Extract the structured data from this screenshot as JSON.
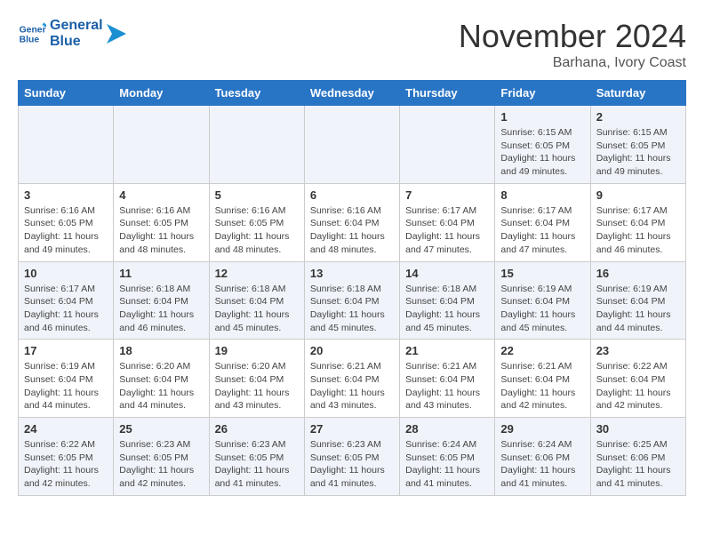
{
  "header": {
    "logo_line1": "General",
    "logo_line2": "Blue",
    "month": "November 2024",
    "location": "Barhana, Ivory Coast"
  },
  "weekdays": [
    "Sunday",
    "Monday",
    "Tuesday",
    "Wednesday",
    "Thursday",
    "Friday",
    "Saturday"
  ],
  "weeks": [
    [
      {
        "day": "",
        "info": ""
      },
      {
        "day": "",
        "info": ""
      },
      {
        "day": "",
        "info": ""
      },
      {
        "day": "",
        "info": ""
      },
      {
        "day": "",
        "info": ""
      },
      {
        "day": "1",
        "info": "Sunrise: 6:15 AM\nSunset: 6:05 PM\nDaylight: 11 hours\nand 49 minutes."
      },
      {
        "day": "2",
        "info": "Sunrise: 6:15 AM\nSunset: 6:05 PM\nDaylight: 11 hours\nand 49 minutes."
      }
    ],
    [
      {
        "day": "3",
        "info": "Sunrise: 6:16 AM\nSunset: 6:05 PM\nDaylight: 11 hours\nand 49 minutes."
      },
      {
        "day": "4",
        "info": "Sunrise: 6:16 AM\nSunset: 6:05 PM\nDaylight: 11 hours\nand 48 minutes."
      },
      {
        "day": "5",
        "info": "Sunrise: 6:16 AM\nSunset: 6:05 PM\nDaylight: 11 hours\nand 48 minutes."
      },
      {
        "day": "6",
        "info": "Sunrise: 6:16 AM\nSunset: 6:04 PM\nDaylight: 11 hours\nand 48 minutes."
      },
      {
        "day": "7",
        "info": "Sunrise: 6:17 AM\nSunset: 6:04 PM\nDaylight: 11 hours\nand 47 minutes."
      },
      {
        "day": "8",
        "info": "Sunrise: 6:17 AM\nSunset: 6:04 PM\nDaylight: 11 hours\nand 47 minutes."
      },
      {
        "day": "9",
        "info": "Sunrise: 6:17 AM\nSunset: 6:04 PM\nDaylight: 11 hours\nand 46 minutes."
      }
    ],
    [
      {
        "day": "10",
        "info": "Sunrise: 6:17 AM\nSunset: 6:04 PM\nDaylight: 11 hours\nand 46 minutes."
      },
      {
        "day": "11",
        "info": "Sunrise: 6:18 AM\nSunset: 6:04 PM\nDaylight: 11 hours\nand 46 minutes."
      },
      {
        "day": "12",
        "info": "Sunrise: 6:18 AM\nSunset: 6:04 PM\nDaylight: 11 hours\nand 45 minutes."
      },
      {
        "day": "13",
        "info": "Sunrise: 6:18 AM\nSunset: 6:04 PM\nDaylight: 11 hours\nand 45 minutes."
      },
      {
        "day": "14",
        "info": "Sunrise: 6:18 AM\nSunset: 6:04 PM\nDaylight: 11 hours\nand 45 minutes."
      },
      {
        "day": "15",
        "info": "Sunrise: 6:19 AM\nSunset: 6:04 PM\nDaylight: 11 hours\nand 45 minutes."
      },
      {
        "day": "16",
        "info": "Sunrise: 6:19 AM\nSunset: 6:04 PM\nDaylight: 11 hours\nand 44 minutes."
      }
    ],
    [
      {
        "day": "17",
        "info": "Sunrise: 6:19 AM\nSunset: 6:04 PM\nDaylight: 11 hours\nand 44 minutes."
      },
      {
        "day": "18",
        "info": "Sunrise: 6:20 AM\nSunset: 6:04 PM\nDaylight: 11 hours\nand 44 minutes."
      },
      {
        "day": "19",
        "info": "Sunrise: 6:20 AM\nSunset: 6:04 PM\nDaylight: 11 hours\nand 43 minutes."
      },
      {
        "day": "20",
        "info": "Sunrise: 6:21 AM\nSunset: 6:04 PM\nDaylight: 11 hours\nand 43 minutes."
      },
      {
        "day": "21",
        "info": "Sunrise: 6:21 AM\nSunset: 6:04 PM\nDaylight: 11 hours\nand 43 minutes."
      },
      {
        "day": "22",
        "info": "Sunrise: 6:21 AM\nSunset: 6:04 PM\nDaylight: 11 hours\nand 42 minutes."
      },
      {
        "day": "23",
        "info": "Sunrise: 6:22 AM\nSunset: 6:04 PM\nDaylight: 11 hours\nand 42 minutes."
      }
    ],
    [
      {
        "day": "24",
        "info": "Sunrise: 6:22 AM\nSunset: 6:05 PM\nDaylight: 11 hours\nand 42 minutes."
      },
      {
        "day": "25",
        "info": "Sunrise: 6:23 AM\nSunset: 6:05 PM\nDaylight: 11 hours\nand 42 minutes."
      },
      {
        "day": "26",
        "info": "Sunrise: 6:23 AM\nSunset: 6:05 PM\nDaylight: 11 hours\nand 41 minutes."
      },
      {
        "day": "27",
        "info": "Sunrise: 6:23 AM\nSunset: 6:05 PM\nDaylight: 11 hours\nand 41 minutes."
      },
      {
        "day": "28",
        "info": "Sunrise: 6:24 AM\nSunset: 6:05 PM\nDaylight: 11 hours\nand 41 minutes."
      },
      {
        "day": "29",
        "info": "Sunrise: 6:24 AM\nSunset: 6:06 PM\nDaylight: 11 hours\nand 41 minutes."
      },
      {
        "day": "30",
        "info": "Sunrise: 6:25 AM\nSunset: 6:06 PM\nDaylight: 11 hours\nand 41 minutes."
      }
    ]
  ]
}
